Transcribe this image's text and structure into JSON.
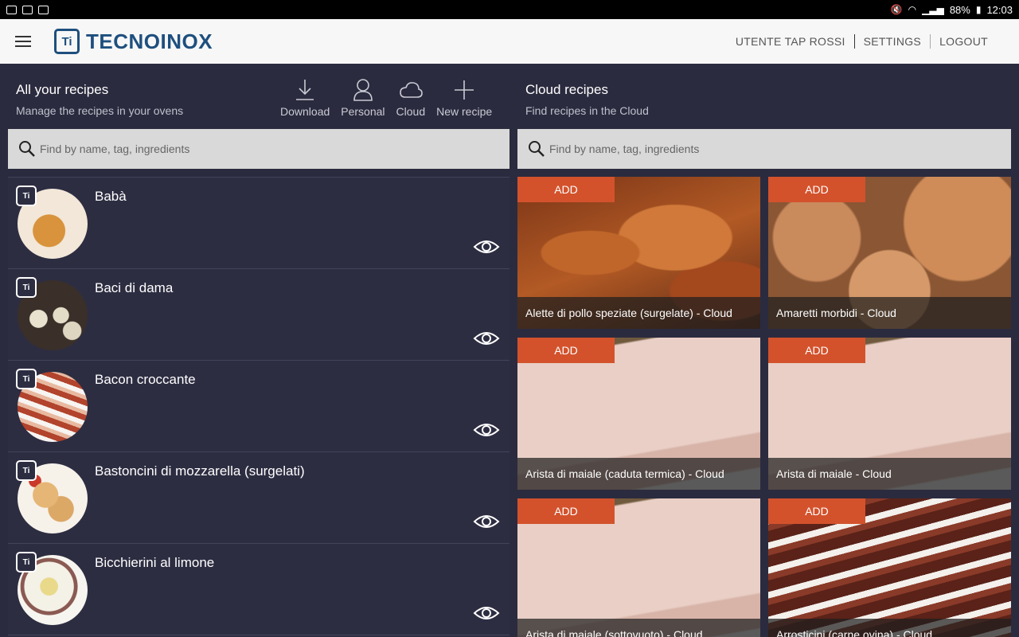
{
  "statusbar": {
    "battery": "88%",
    "time": "12:03"
  },
  "header": {
    "brand": "TECNOINOX",
    "logo_mark": "Ti",
    "user": "UTENTE TAP ROSSI",
    "settings": "SETTINGS",
    "logout": "LOGOUT"
  },
  "left": {
    "title": "All your recipes",
    "subtitle": "Manage the recipes in your ovens",
    "tools": [
      {
        "label": "Download",
        "icon": "download-icon"
      },
      {
        "label": "Personal",
        "icon": "person-icon"
      },
      {
        "label": "Cloud",
        "icon": "cloud-icon"
      },
      {
        "label": "New recipe",
        "icon": "plus-icon"
      }
    ],
    "search_placeholder": "Find by name, tag, ingredients",
    "recipes": [
      {
        "name": "Babà"
      },
      {
        "name": "Baci di dama"
      },
      {
        "name": "Bacon croccante"
      },
      {
        "name": "Bastoncini di mozzarella (surgelati)"
      },
      {
        "name": "Bicchierini al limone"
      }
    ]
  },
  "right": {
    "title": "Cloud recipes",
    "subtitle": "Find recipes in the Cloud",
    "search_placeholder": "Find by name, tag, ingredients",
    "add_label": "ADD",
    "cards": [
      {
        "caption": "Alette di pollo speziate (surgelate) - Cloud"
      },
      {
        "caption": "Amaretti morbidi - Cloud"
      },
      {
        "caption": "Arista di maiale (caduta termica) - Cloud"
      },
      {
        "caption": "Arista di maiale - Cloud"
      },
      {
        "caption": "Arista di maiale (sottovuoto) - Cloud"
      },
      {
        "caption": "Arrosticini (carne ovina) - Cloud"
      }
    ]
  }
}
